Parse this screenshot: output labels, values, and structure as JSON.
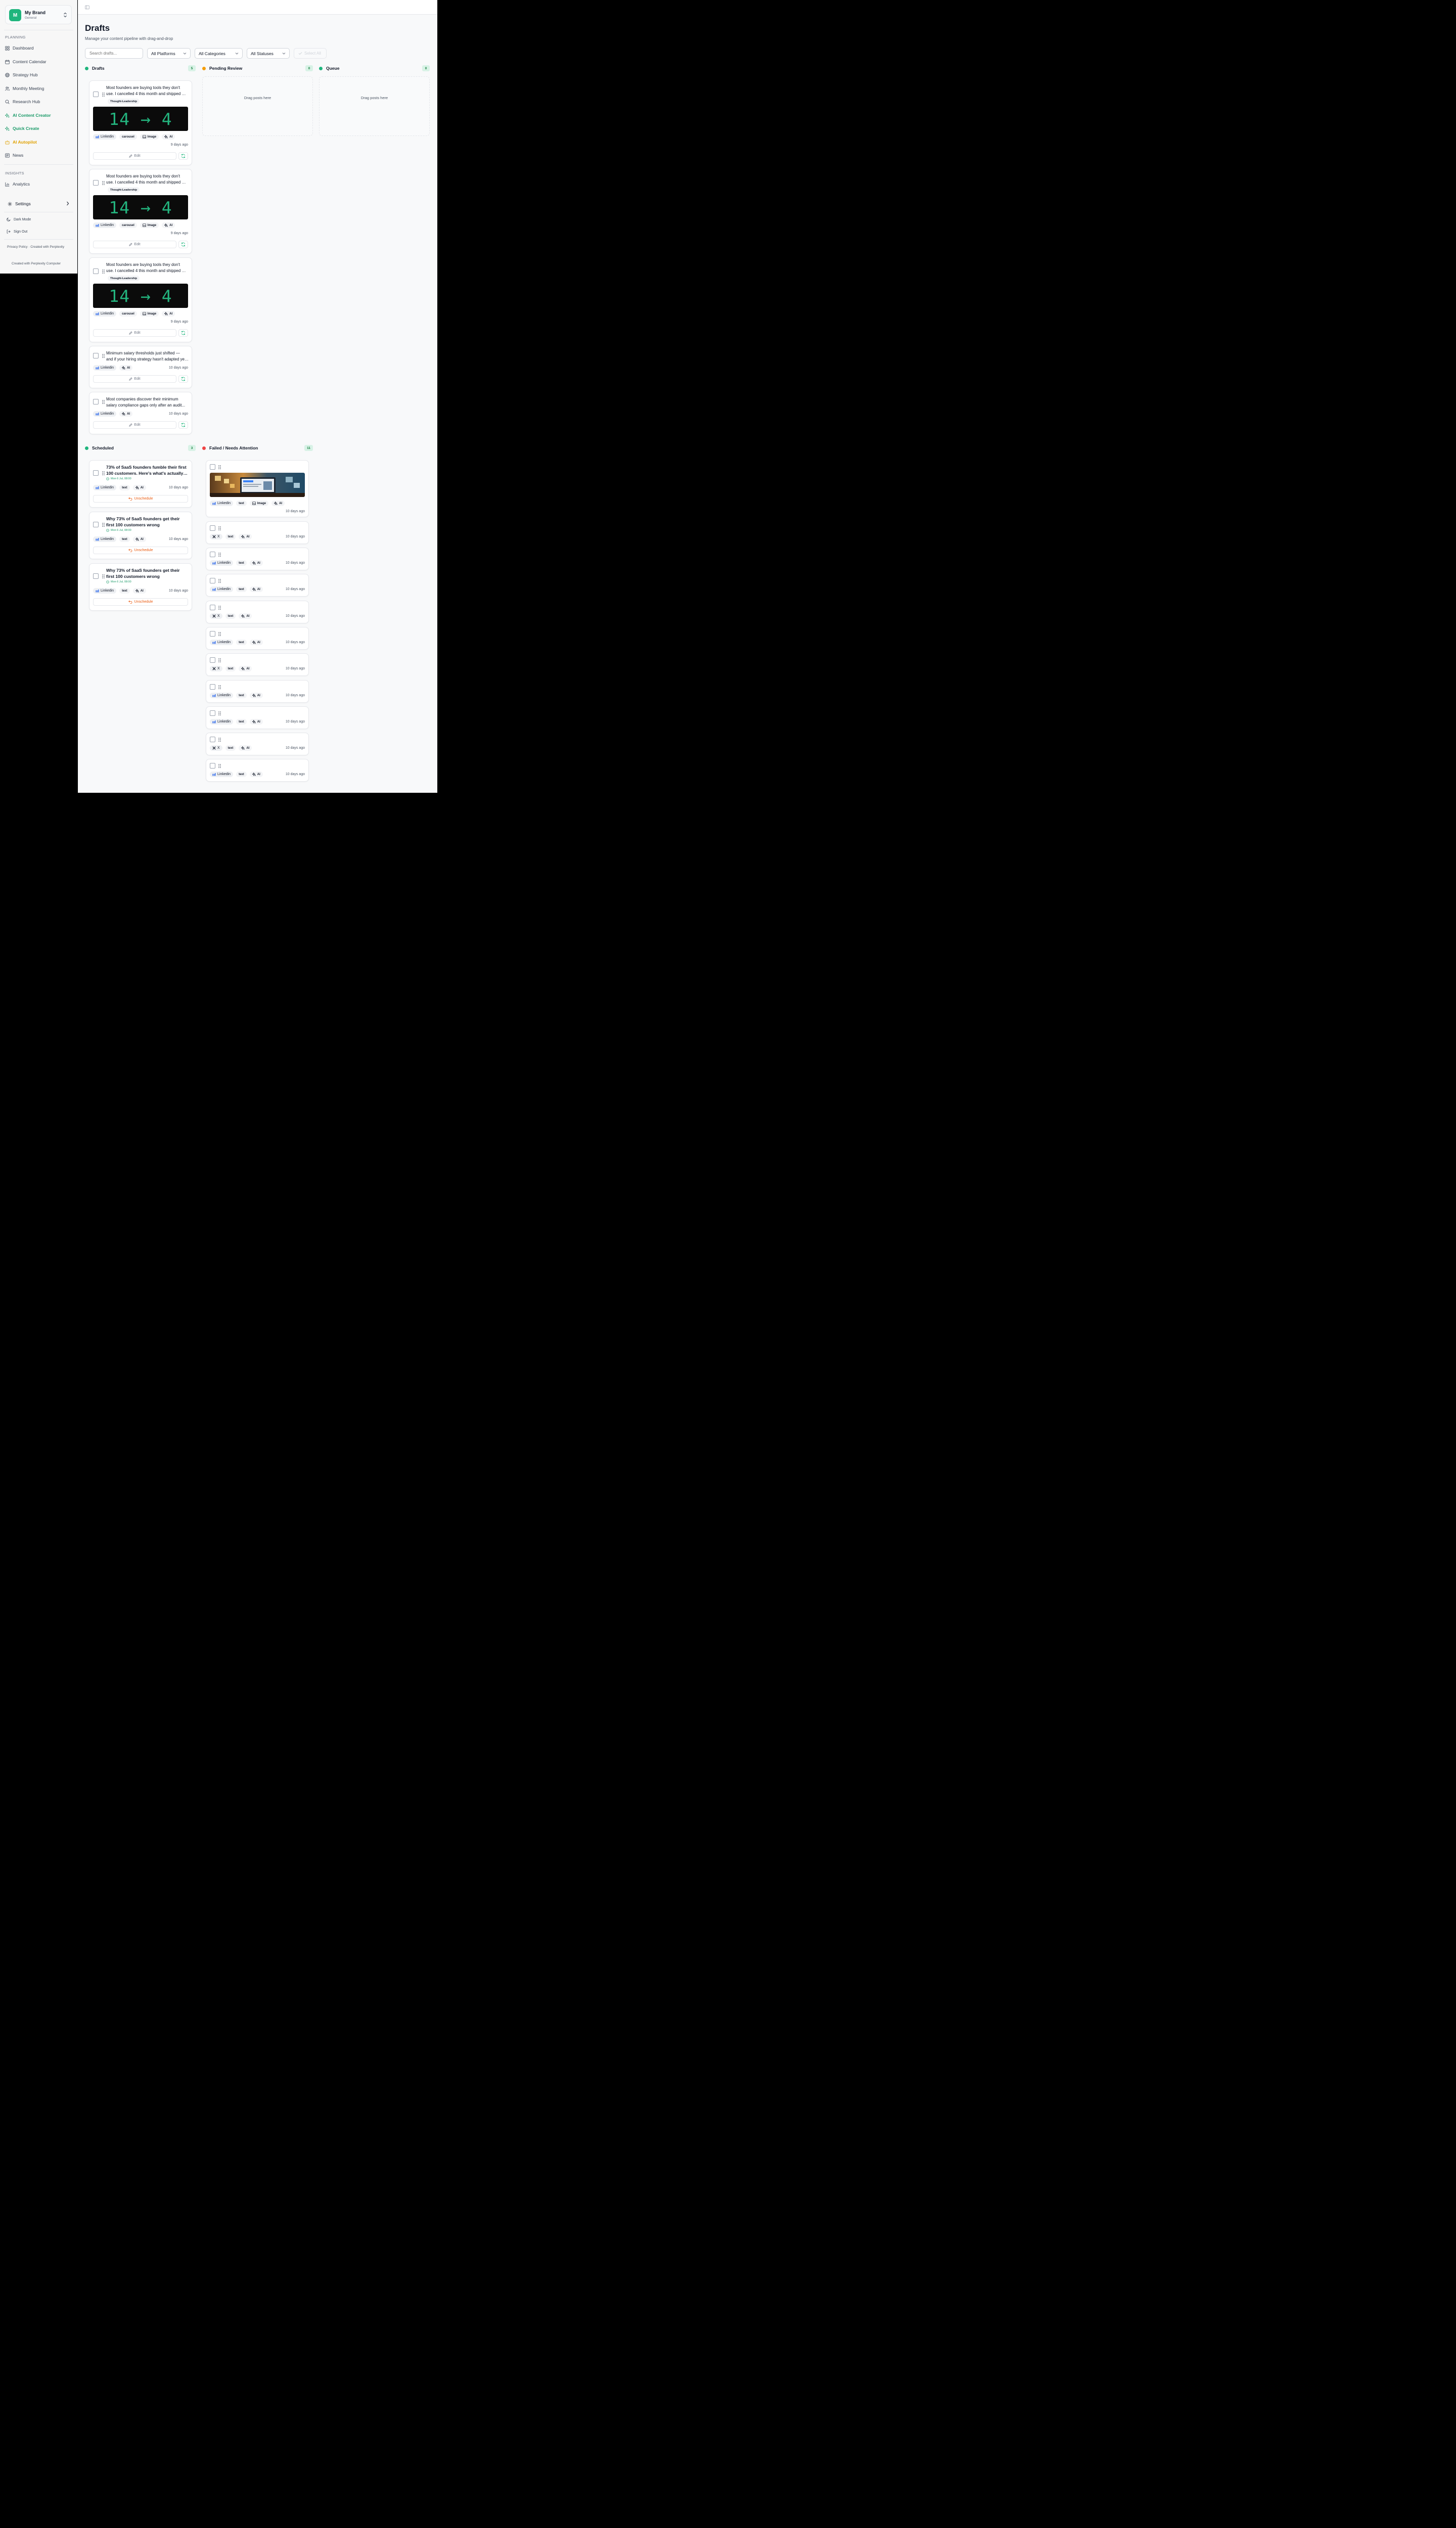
{
  "brand": {
    "initial": "M",
    "name": "My Brand",
    "workspace": "General"
  },
  "sidebar": {
    "planning_label": "PLANNING",
    "items": [
      {
        "label": "Dashboard",
        "icon": "grid-icon"
      },
      {
        "label": "Content Calendar",
        "icon": "calendar-icon"
      },
      {
        "label": "Strategy Hub",
        "icon": "target-icon"
      },
      {
        "label": "Monthly Meeting",
        "icon": "users-icon"
      },
      {
        "label": "Research Hub",
        "icon": "search-icon"
      },
      {
        "label": "AI Content Creator",
        "icon": "sparkles-icon"
      },
      {
        "label": "Quick Create",
        "icon": "sparkles-icon"
      },
      {
        "label": "AI Autopilot",
        "icon": "bot-icon"
      },
      {
        "label": "News",
        "icon": "newspaper-icon"
      }
    ],
    "insights_label": "INSIGHTS",
    "analytics": "Analytics",
    "settings": "Settings",
    "dark_mode": "Dark Mode",
    "sign_out": "Sign Out",
    "footer_links": "Privacy Policy · Created with Perplexity",
    "footer_credit": "Created with Perplexity Computer",
    "colors": {
      "brand_green": "#1fb57d",
      "ai_green": "#1a9a68",
      "autopilot_amber": "#e0a100"
    }
  },
  "page": {
    "title": "Drafts",
    "subtitle": "Manage your content pipeline with drag-and-drop"
  },
  "filters": {
    "search_placeholder": "Search drafts...",
    "platforms": "All Platforms",
    "categories": "All Categories",
    "statuses": "All Statuses",
    "select_all": "Select All"
  },
  "columns": {
    "drafts": {
      "title": "Drafts",
      "count": "5",
      "color": "#1fb57d"
    },
    "pending": {
      "title": "Pending Review",
      "count": "0",
      "color": "#f59e0b",
      "empty": "Drag posts here"
    },
    "queue": {
      "title": "Queue",
      "count": "0",
      "color": "#1fb57d",
      "empty": "Drag posts here"
    },
    "scheduled": {
      "title": "Scheduled",
      "count": "3",
      "color": "#1fb57d"
    },
    "failed": {
      "title": "Failed / Needs Attention",
      "count": "11",
      "color": "#ef4444"
    }
  },
  "drafts": [
    {
      "line1": "Most founders are buying tools they don't",
      "line2": "use. I cancelled 4 this month and shipped more.",
      "category": "Thought-Leadership",
      "image_text": "14 → 4",
      "platform": "Linkedin",
      "format": "carousel",
      "image": "Image",
      "ai": "AI",
      "ago": "9 days ago",
      "edit": "Edit"
    },
    {
      "line1": "Most founders are buying tools they don't",
      "line2": "use. I cancelled 4 this month and shipped more.",
      "category": "Thought-Leadership",
      "image_text": "14 → 4",
      "platform": "Linkedin",
      "format": "carousel",
      "image": "Image",
      "ai": "AI",
      "ago": "9 days ago",
      "edit": "Edit"
    },
    {
      "line1": "Most founders are buying tools they don't",
      "line2": "use. I cancelled 4 this month and shipped more.",
      "category": "Thought-Leadership",
      "image_text": "14 → 4",
      "platform": "Linkedin",
      "format": "carousel",
      "image": "Image",
      "ai": "AI",
      "ago": "9 days ago",
      "edit": "Edit"
    },
    {
      "line1": "Minimum salary thresholds just shifted —",
      "line2": "and if your hiring strategy hasn't adapted yet...",
      "platform": "Linkedin",
      "ai": "AI",
      "ago": "10 days ago",
      "edit": "Edit"
    },
    {
      "line1": "Most companies discover their minimum",
      "line2": "salary compliance gaps only after an audit...",
      "platform": "Linkedin",
      "ai": "AI",
      "ago": "10 days ago",
      "edit": "Edit"
    }
  ],
  "scheduled": [
    {
      "line1": "73% of SaaS founders fumble their first",
      "line2": "100 customers. Here's what's actually going on.",
      "date": "Mon 6 Jul, 08:00",
      "platform": "Linkedin",
      "format": "text",
      "ai": "AI",
      "ago": "10 days ago",
      "action": "Unschedule"
    },
    {
      "line1": "Why 73% of SaaS founders get their",
      "line2": "first 100 customers wrong",
      "date": "Mon 6 Jul, 08:00",
      "platform": "Linkedin",
      "format": "text",
      "ai": "AI",
      "ago": "10 days ago",
      "action": "Unschedule"
    },
    {
      "line1": "Why 73% of SaaS founders get their",
      "line2": "first 100 customers wrong",
      "date": "Mon 6 Jul, 08:00",
      "platform": "Linkedin",
      "format": "text",
      "ai": "AI",
      "ago": "10 days ago",
      "action": "Unschedule"
    }
  ],
  "failed": [
    {
      "platform": "Linkedin",
      "format": "text",
      "image": "Image",
      "ai": "AI",
      "ago": "10 days ago"
    },
    {
      "platform": "X",
      "format": "text",
      "ai": "AI",
      "ago": "10 days ago"
    },
    {
      "platform": "Linkedin",
      "format": "text",
      "ai": "AI",
      "ago": "10 days ago"
    },
    {
      "platform": "Linkedin",
      "format": "text",
      "ai": "AI",
      "ago": "10 days ago"
    },
    {
      "platform": "X",
      "format": "text",
      "ai": "AI",
      "ago": "10 days ago"
    },
    {
      "platform": "Linkedin",
      "format": "text",
      "ai": "AI",
      "ago": "10 days ago"
    },
    {
      "platform": "X",
      "format": "text",
      "ai": "AI",
      "ago": "10 days ago"
    },
    {
      "platform": "Linkedin",
      "format": "text",
      "ai": "AI",
      "ago": "10 days ago"
    },
    {
      "platform": "Linkedin",
      "format": "text",
      "ai": "AI",
      "ago": "10 days ago"
    },
    {
      "platform": "X",
      "format": "text",
      "ai": "AI",
      "ago": "10 days ago"
    },
    {
      "platform": "Linkedin",
      "format": "text",
      "ai": "AI",
      "ago": "10 days ago"
    }
  ]
}
